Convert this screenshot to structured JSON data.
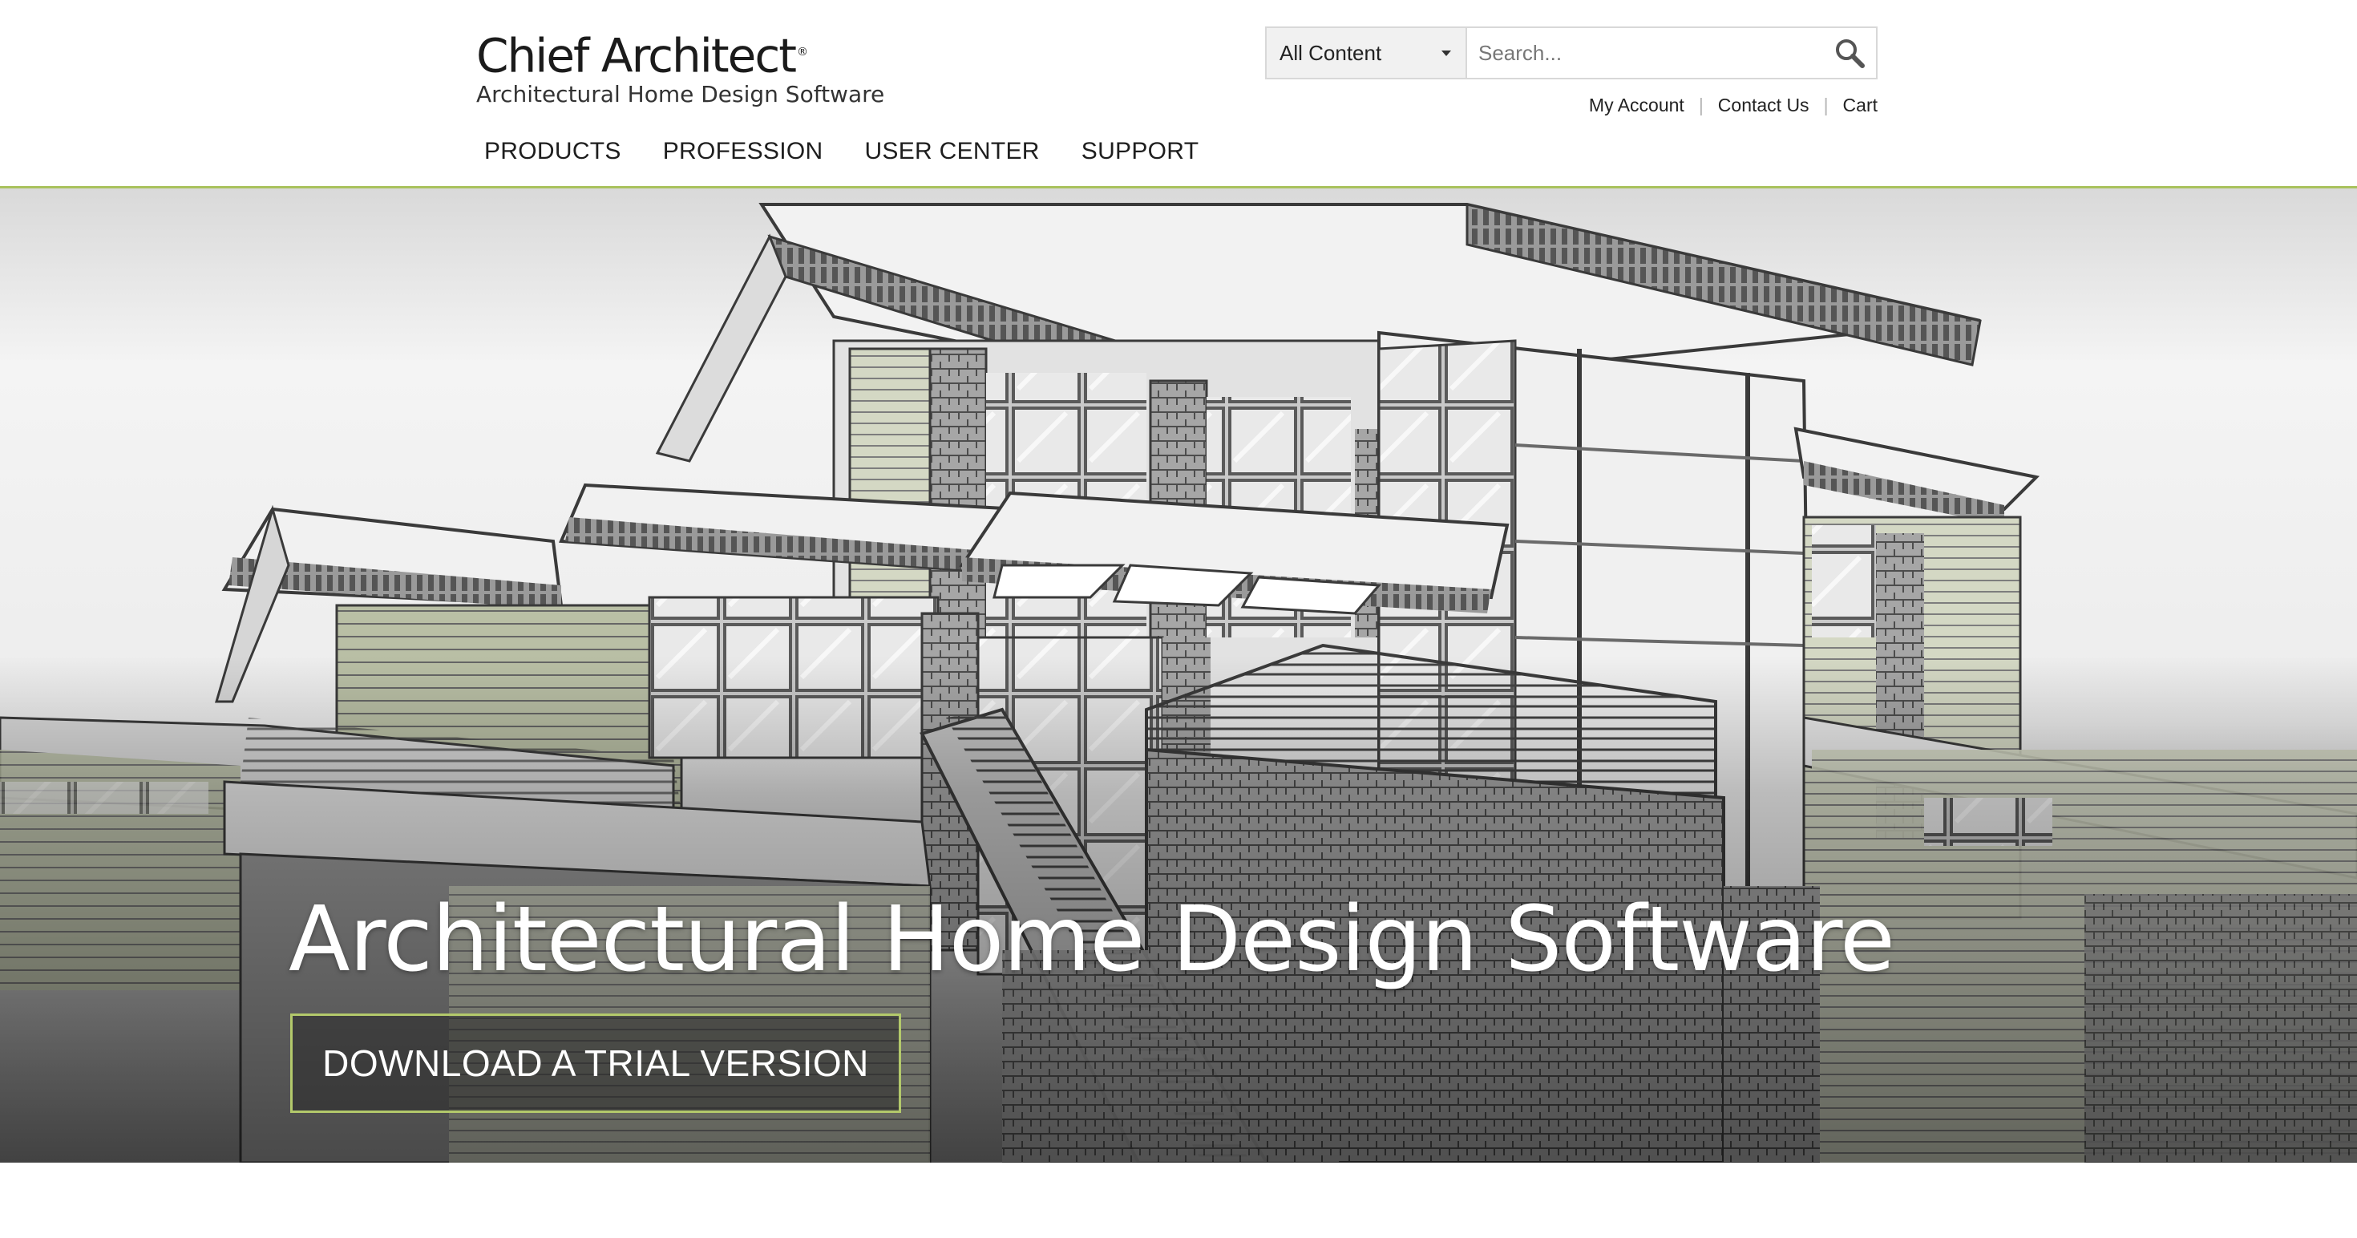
{
  "brand": {
    "name": "Chief Architect",
    "registered_mark": "®",
    "tagline": "Architectural Home Design Software"
  },
  "search": {
    "scope_selected": "All Content",
    "placeholder": "Search...",
    "icon": "search-icon"
  },
  "utility_links": [
    "My Account",
    "Contact Us",
    "Cart"
  ],
  "utility_separator": "|",
  "nav": {
    "items": [
      "PRODUCTS",
      "PROFESSION",
      "USER CENTER",
      "SUPPORT"
    ]
  },
  "hero": {
    "title": "Architectural Home Design Software",
    "cta_label": "DOWNLOAD A TRIAL VERSION",
    "image": "house-rendering-illustration"
  },
  "colors": {
    "accent_green": "#a9c25d",
    "cta_border": "#b3c96b"
  }
}
